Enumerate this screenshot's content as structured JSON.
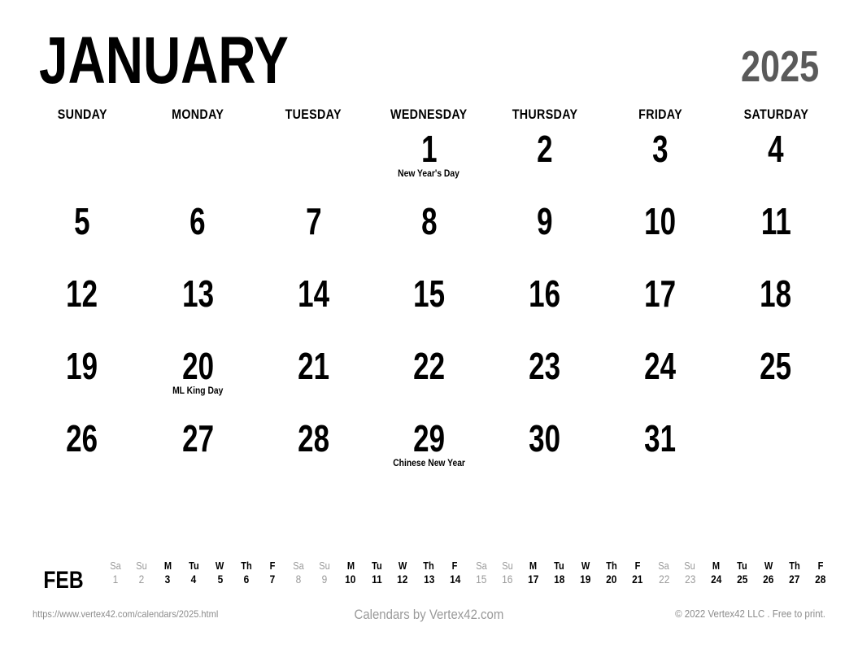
{
  "header": {
    "month": "JANUARY",
    "year": "2025",
    "year_color": "#5a5a5a"
  },
  "weekdays": [
    "SUNDAY",
    "MONDAY",
    "TUESDAY",
    "WEDNESDAY",
    "THURSDAY",
    "FRIDAY",
    "SATURDAY"
  ],
  "weeks": [
    [
      {
        "day": "",
        "event": ""
      },
      {
        "day": "",
        "event": ""
      },
      {
        "day": "",
        "event": ""
      },
      {
        "day": "1",
        "event": "New Year's Day"
      },
      {
        "day": "2",
        "event": ""
      },
      {
        "day": "3",
        "event": ""
      },
      {
        "day": "4",
        "event": ""
      }
    ],
    [
      {
        "day": "5",
        "event": ""
      },
      {
        "day": "6",
        "event": ""
      },
      {
        "day": "7",
        "event": ""
      },
      {
        "day": "8",
        "event": ""
      },
      {
        "day": "9",
        "event": ""
      },
      {
        "day": "10",
        "event": ""
      },
      {
        "day": "11",
        "event": ""
      }
    ],
    [
      {
        "day": "12",
        "event": ""
      },
      {
        "day": "13",
        "event": ""
      },
      {
        "day": "14",
        "event": ""
      },
      {
        "day": "15",
        "event": ""
      },
      {
        "day": "16",
        "event": ""
      },
      {
        "day": "17",
        "event": ""
      },
      {
        "day": "18",
        "event": ""
      }
    ],
    [
      {
        "day": "19",
        "event": ""
      },
      {
        "day": "20",
        "event": "ML King Day"
      },
      {
        "day": "21",
        "event": ""
      },
      {
        "day": "22",
        "event": ""
      },
      {
        "day": "23",
        "event": ""
      },
      {
        "day": "24",
        "event": ""
      },
      {
        "day": "25",
        "event": ""
      }
    ],
    [
      {
        "day": "26",
        "event": ""
      },
      {
        "day": "27",
        "event": ""
      },
      {
        "day": "28",
        "event": ""
      },
      {
        "day": "29",
        "event": "Chinese New Year"
      },
      {
        "day": "30",
        "event": ""
      },
      {
        "day": "31",
        "event": ""
      },
      {
        "day": "",
        "event": ""
      }
    ]
  ],
  "mini_month": {
    "label": "FEB",
    "days": [
      {
        "dow": "Sa",
        "num": "1",
        "weekend": true
      },
      {
        "dow": "Su",
        "num": "2",
        "weekend": true
      },
      {
        "dow": "M",
        "num": "3",
        "weekend": false
      },
      {
        "dow": "Tu",
        "num": "4",
        "weekend": false
      },
      {
        "dow": "W",
        "num": "5",
        "weekend": false
      },
      {
        "dow": "Th",
        "num": "6",
        "weekend": false
      },
      {
        "dow": "F",
        "num": "7",
        "weekend": false
      },
      {
        "dow": "Sa",
        "num": "8",
        "weekend": true
      },
      {
        "dow": "Su",
        "num": "9",
        "weekend": true
      },
      {
        "dow": "M",
        "num": "10",
        "weekend": false
      },
      {
        "dow": "Tu",
        "num": "11",
        "weekend": false
      },
      {
        "dow": "W",
        "num": "12",
        "weekend": false
      },
      {
        "dow": "Th",
        "num": "13",
        "weekend": false
      },
      {
        "dow": "F",
        "num": "14",
        "weekend": false
      },
      {
        "dow": "Sa",
        "num": "15",
        "weekend": true
      },
      {
        "dow": "Su",
        "num": "16",
        "weekend": true
      },
      {
        "dow": "M",
        "num": "17",
        "weekend": false
      },
      {
        "dow": "Tu",
        "num": "18",
        "weekend": false
      },
      {
        "dow": "W",
        "num": "19",
        "weekend": false
      },
      {
        "dow": "Th",
        "num": "20",
        "weekend": false
      },
      {
        "dow": "F",
        "num": "21",
        "weekend": false
      },
      {
        "dow": "Sa",
        "num": "22",
        "weekend": true
      },
      {
        "dow": "Su",
        "num": "23",
        "weekend": true
      },
      {
        "dow": "M",
        "num": "24",
        "weekend": false
      },
      {
        "dow": "Tu",
        "num": "25",
        "weekend": false
      },
      {
        "dow": "W",
        "num": "26",
        "weekend": false
      },
      {
        "dow": "Th",
        "num": "27",
        "weekend": false
      },
      {
        "dow": "F",
        "num": "28",
        "weekend": false
      }
    ]
  },
  "footer": {
    "url": "https://www.vertex42.com/calendars/2025.html",
    "center": "Calendars by Vertex42.com",
    "copyright": "© 2022 Vertex42 LLC . Free to print."
  }
}
